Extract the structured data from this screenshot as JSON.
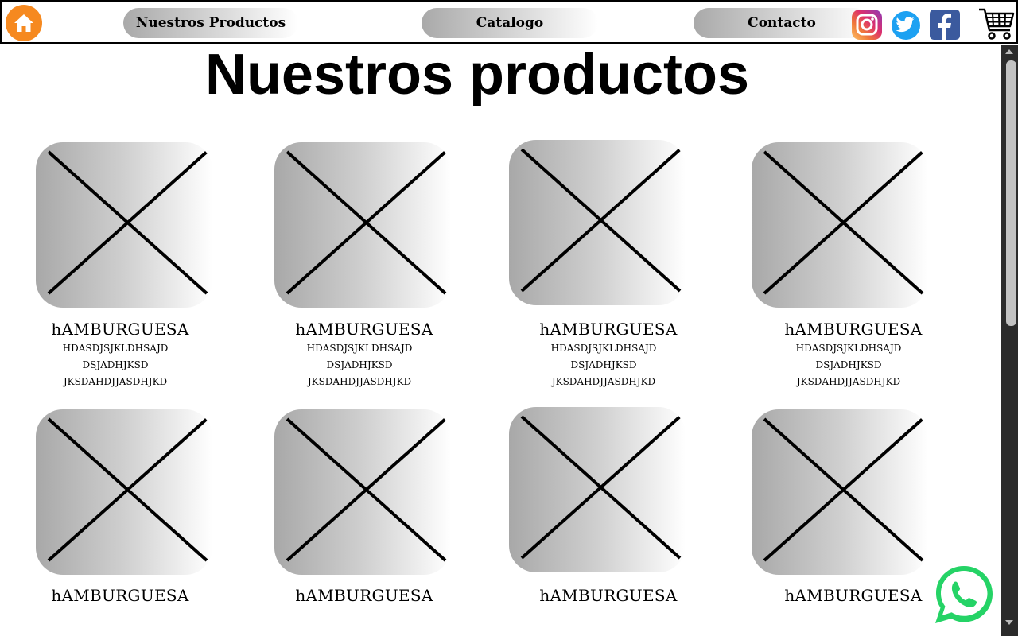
{
  "nav": {
    "home_icon": "home-icon",
    "links": [
      "Nuestros Productos",
      "Catalogo",
      "Contacto"
    ],
    "social_icons": [
      "instagram-icon",
      "twitter-icon",
      "facebook-icon"
    ],
    "cart_icon": "shopping-cart-icon",
    "colors": {
      "home": "#f6891f",
      "instagram": "#dc2f6e",
      "twitter": "#1da1f2",
      "facebook": "#3b5a9e"
    }
  },
  "page_title": "Nuestros productos",
  "products": [
    {
      "name": "hAMBURGUESA",
      "desc": [
        "HDASDJSJKLDHSAJD",
        "DSJADHJKSD",
        "JKSDAHDJJASDHJKD"
      ]
    },
    {
      "name": "hAMBURGUESA",
      "desc": [
        "HDASDJSJKLDHSAJD",
        "DSJADHJKSD",
        "JKSDAHDJJASDHJKD"
      ]
    },
    {
      "name": "hAMBURGUESA",
      "desc": [
        "HDASDJSJKLDHSAJD",
        "DSJADHJKSD",
        "JKSDAHDJJASDHJKD"
      ]
    },
    {
      "name": "hAMBURGUESA",
      "desc": [
        "HDASDJSJKLDHSAJD",
        "DSJADHJKSD",
        "JKSDAHDJJASDHJKD"
      ]
    },
    {
      "name": "hAMBURGUESA"
    },
    {
      "name": "hAMBURGUESA"
    },
    {
      "name": "hAMBURGUESA"
    },
    {
      "name": "hAMBURGUESA"
    }
  ],
  "whatsapp": {
    "icon": "whatsapp-icon",
    "color": "#25d366"
  }
}
